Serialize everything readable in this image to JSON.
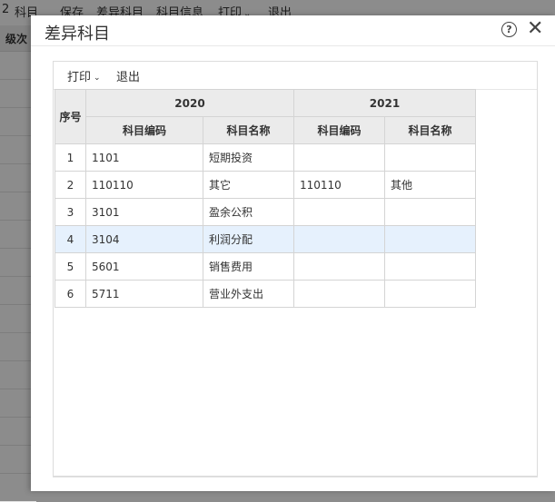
{
  "background_app": {
    "menu": [
      "2",
      "科目",
      "保存",
      "差异科目",
      "科目信息",
      "打印",
      "退出"
    ],
    "print_caret": "⌄",
    "column_header": "级次"
  },
  "dialog": {
    "title": "差异科目",
    "help_icon": "?",
    "close_icon": "✕"
  },
  "toolbar": {
    "print_label": "打印",
    "print_caret": "⌄",
    "exit_label": "退出"
  },
  "table": {
    "index_header": "序号",
    "year_groups": [
      "2020",
      "2021"
    ],
    "sub_headers": [
      "科目编码",
      "科目名称",
      "科目编码",
      "科目名称"
    ],
    "rows": [
      {
        "idx": "1",
        "code2020": "1101",
        "name2020": "短期投资",
        "code2021": "",
        "name2021": ""
      },
      {
        "idx": "2",
        "code2020": "110110",
        "name2020": "其它",
        "code2021": "110110",
        "name2021": "其他"
      },
      {
        "idx": "3",
        "code2020": "3101",
        "name2020": "盈余公积",
        "code2021": "",
        "name2021": ""
      },
      {
        "idx": "4",
        "code2020": "3104",
        "name2020": "利润分配",
        "code2021": "",
        "name2021": ""
      },
      {
        "idx": "5",
        "code2020": "5601",
        "name2020": "销售费用",
        "code2021": "",
        "name2021": ""
      },
      {
        "idx": "6",
        "code2020": "5711",
        "name2020": "营业外支出",
        "code2021": "",
        "name2021": ""
      }
    ],
    "selected_row": "4"
  }
}
